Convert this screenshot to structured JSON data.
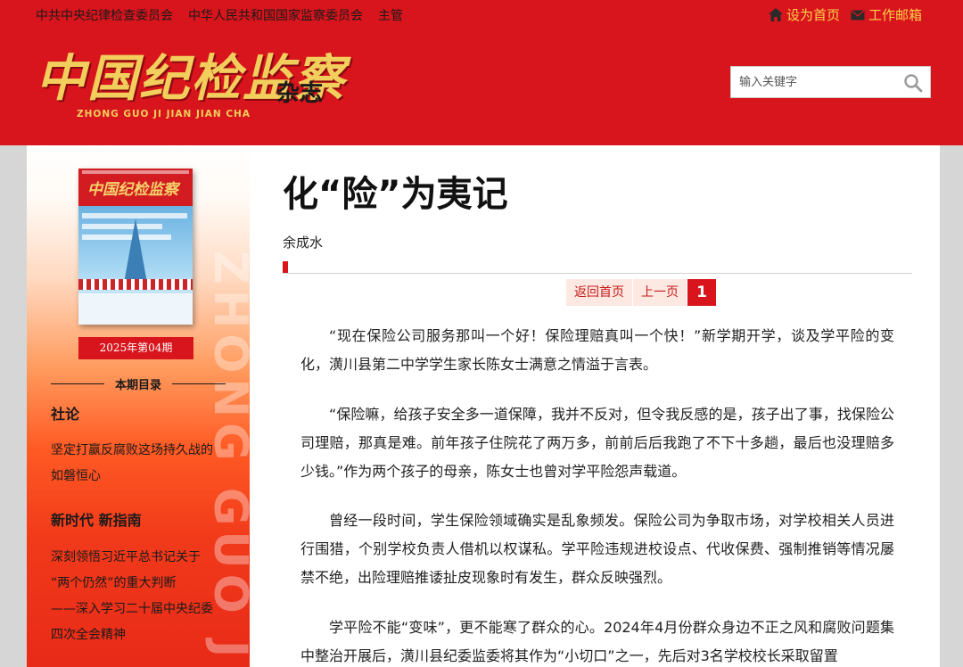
{
  "topbar": {
    "links": [
      "中共中央纪律检查委员会",
      "中华人民共和国国家监察委员会",
      "主管"
    ],
    "set_home": "设为首页",
    "work_mail": "工作邮箱"
  },
  "logo": {
    "main": "中国纪检监察",
    "sub": "杂志",
    "pinyin": "ZHONG GUO JI JIAN JIAN CHA"
  },
  "search": {
    "placeholder": "输入关键字"
  },
  "sidebar": {
    "cover_title": "中国纪检监察",
    "issue": "2025年第04期",
    "watermark": "ZHONG GUO JI",
    "toc_label": "本期目录",
    "sections": [
      {
        "title": "社论",
        "items": [
          "坚定打赢反腐败这场持久战的",
          "如磐恒心"
        ]
      },
      {
        "title": "新时代  新指南",
        "items": [
          "深刻领悟习近平总书记关于",
          "“两个仍然”的重大判断",
          "——深入学习二十届中央纪委",
          "四次全会精神"
        ]
      }
    ]
  },
  "article": {
    "title": "化“险”为夷记",
    "author": "余成水",
    "pager": {
      "home": "返回首页",
      "prev": "上一页",
      "current": "1"
    },
    "paragraphs": [
      "“现在保险公司服务那叫一个好！保险理赔真叫一个快！”新学期开学，谈及学平险的变化，潢川县第二中学学生家长陈女士满意之情溢于言表。",
      "“保险嘛，给孩子安全多一道保障，我并不反对，但令我反感的是，孩子出了事，找保险公司理赔，那真是难。前年孩子住院花了两万多，前前后后我跑了不下十多趟，最后也没理赔多少钱。”作为两个孩子的母亲，陈女士也曾对学平险怨声载道。",
      "曾经一段时间，学生保险领域确实是乱象频发。保险公司为争取市场，对学校相关人员进行围猎，个别学校负责人借机以权谋私。学平险违规进校设点、代收保费、强制推销等情况屡禁不绝，出险理赔推诿扯皮现象时有发生，群众反映强烈。",
      "学平险不能“变味”，更不能寒了群众的心。2024年4月份群众身边不正之风和腐败问题集中整治开展后，潢川县纪委监委将其作为“小切口”之一，先后对3名学校校长采取留置"
    ]
  },
  "colors": {
    "brand_red": "#d8141c",
    "gold": "#f2cf5c",
    "link_yellow": "#ffd24a"
  }
}
